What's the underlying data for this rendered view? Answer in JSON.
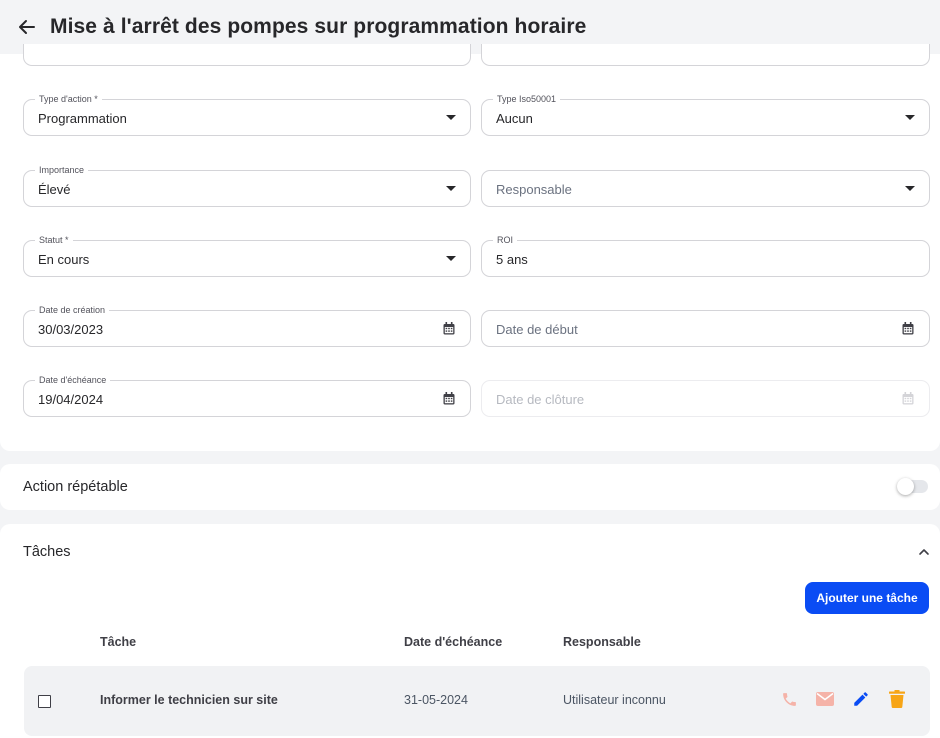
{
  "header": {
    "title": "Mise à l'arrêt des pompes sur programmation horaire"
  },
  "form": {
    "type_action": {
      "label": "Type d'action *",
      "value": "Programmation"
    },
    "type_iso": {
      "label": "Type Iso50001",
      "value": "Aucun"
    },
    "importance": {
      "label": "Importance",
      "value": "Élevé"
    },
    "responsable": {
      "placeholder": "Responsable"
    },
    "statut": {
      "label": "Statut *",
      "value": "En cours"
    },
    "roi": {
      "label": "ROI",
      "value": "5 ans"
    },
    "date_creation": {
      "label": "Date de création",
      "value": "30/03/2023"
    },
    "date_debut": {
      "placeholder": "Date de début"
    },
    "date_echeance": {
      "label": "Date d'échéance",
      "value": "19/04/2024"
    },
    "date_cloture": {
      "placeholder": "Date de clôture"
    }
  },
  "repeatable": {
    "label": "Action répétable",
    "enabled": false
  },
  "tasks": {
    "title": "Tâches",
    "add_button": "Ajouter une tâche",
    "columns": {
      "task": "Tâche",
      "due": "Date d'échéance",
      "owner": "Responsable"
    },
    "rows": [
      {
        "task": "Informer le technicien sur site",
        "due": "31-05-2024",
        "owner": "Utilisateur inconnu"
      }
    ]
  },
  "icons": {
    "back": "arrow-left-icon",
    "caret": "caret-down-icon",
    "calendar": "calendar-icon",
    "collapse": "chevron-up-icon",
    "phone": "phone-icon",
    "mail": "mail-icon",
    "edit": "pencil-icon",
    "delete": "trash-icon"
  },
  "colors": {
    "accent": "#0a4cf4",
    "phone_icon": "#f5b3a8",
    "mail_icon": "#f5b3a8",
    "edit_icon": "#0a4cf4",
    "delete_icon": "#f7a516"
  }
}
